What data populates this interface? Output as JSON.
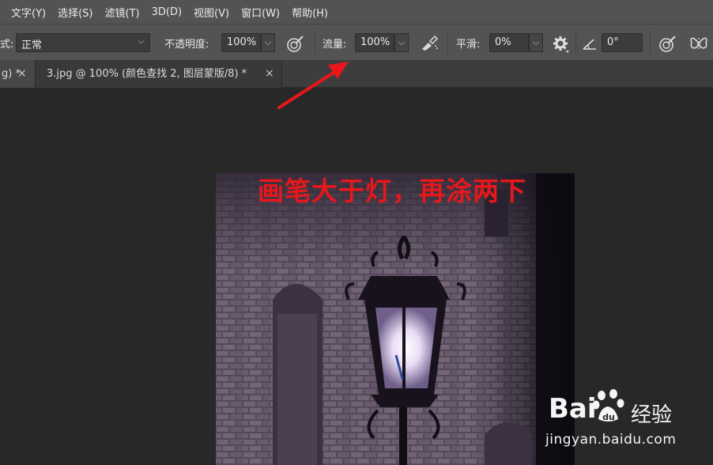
{
  "menu": [
    "文字(Y)",
    "选择(S)",
    "滤镜(T)",
    "3D(D)",
    "视图(V)",
    "窗口(W)",
    "帮助(H)"
  ],
  "options": {
    "mode_label": "式:",
    "mode_value": "正常",
    "opacity_label": "不透明度:",
    "opacity_value": "100%",
    "flow_label": "流量:",
    "flow_value": "100%",
    "smoothing_label": "平滑:",
    "smoothing_value": "0%",
    "angle_value": "0°"
  },
  "tabs": [
    {
      "label": "g) *",
      "close": "×"
    },
    {
      "label": "3.jpg @ 100% (颜色查找 2, 图层蒙版/8) *",
      "close": "×"
    }
  ],
  "annotation": "画笔大于灯，再涂两下",
  "annotation_color": "#e8171b",
  "watermark": {
    "brand": "Bai",
    "brand_suffix": "经验",
    "url": "jingyan.baidu.com"
  },
  "colors": {
    "menubar": "#535353",
    "optbar": "#535353",
    "workspace": "#282828",
    "arrow": "#e8171b"
  },
  "icons": [
    "airbrush-icon",
    "pressure-opacity-icon",
    "settings-gear-icon",
    "angle-icon",
    "pressure-size-icon",
    "symmetry-butterfly-icon"
  ]
}
